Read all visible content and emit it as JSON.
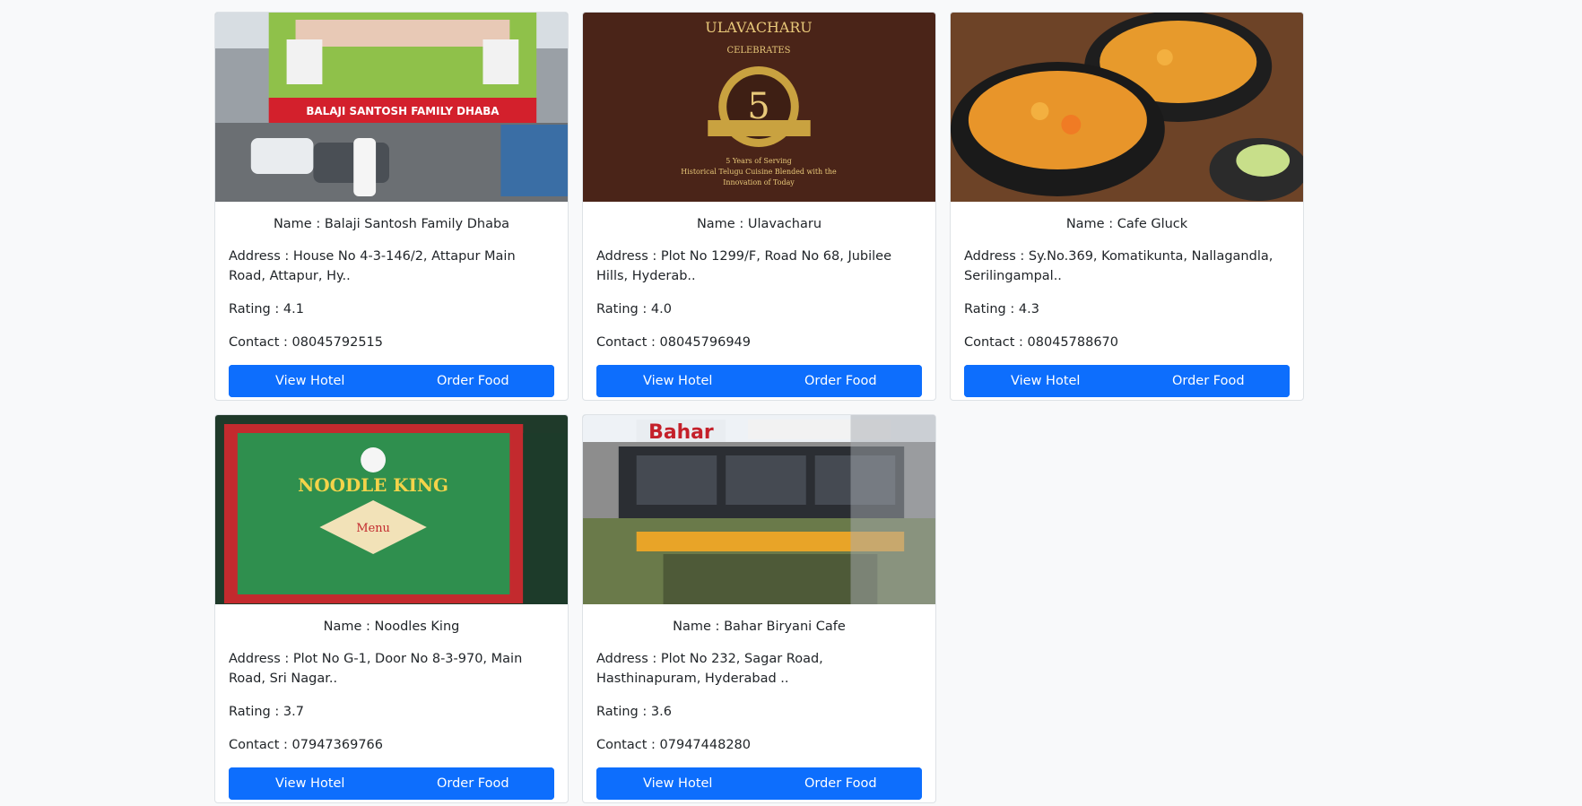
{
  "labels": {
    "name_prefix": "Name : ",
    "address_prefix": "Address : ",
    "rating_prefix": "Rating : ",
    "contact_prefix": "Contact : ",
    "view_hotel": "View Hotel",
    "order_food": "Order Food"
  },
  "colors": {
    "primary": "#0d6efd",
    "page_bg": "#f8f9fa"
  },
  "hotels": [
    {
      "name": "Balaji Santosh Family Dhaba",
      "address": "House No 4-3-146/2, Attapur Main Road, Attapur, Hy..",
      "rating": "4.1",
      "contact": "08045792515",
      "image_sign": "BALAJI SANTOSH FAMILY DHABA"
    },
    {
      "name": "Ulavacharu",
      "address": "Plot No 1299/F, Road No 68, Jubilee Hills, Hyderab..",
      "rating": "4.0",
      "contact": "08045796949",
      "image_sign": "ULAVACHARU"
    },
    {
      "name": "Cafe Gluck",
      "address": "Sy.No.369, Komatikunta, Nallagandla, Serilingampal..",
      "rating": "4.3",
      "contact": "08045788670",
      "image_sign": ""
    },
    {
      "name": "Noodles King",
      "address": "Plot No G-1, Door No 8-3-970, Main Road, Sri Nagar..",
      "rating": "3.7",
      "contact": "07947369766",
      "image_sign": "NOODLE KING"
    },
    {
      "name": "Bahar Biryani Cafe",
      "address": "Plot No 232, Sagar Road, Hasthinapuram, Hyderabad ..",
      "rating": "3.6",
      "contact": "07947448280",
      "image_sign": "Bahar"
    }
  ]
}
